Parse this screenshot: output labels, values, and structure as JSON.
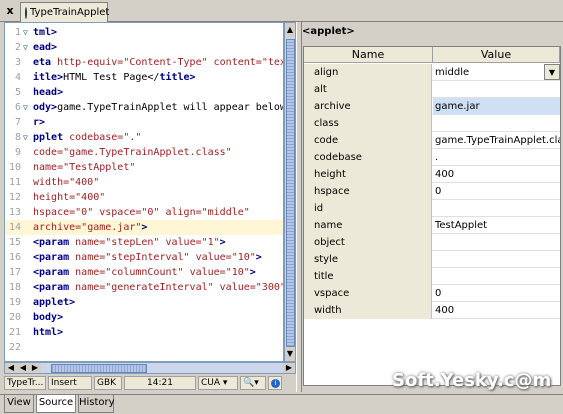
{
  "tab": {
    "title": "TypeTrainApplet",
    "close": "x"
  },
  "editor": {
    "lines": [
      {
        "n": "1",
        "fold": "▽",
        "segs": [
          [
            "tag",
            "tml>"
          ]
        ]
      },
      {
        "n": "2",
        "fold": "▽",
        "segs": [
          [
            "tag",
            "ead>"
          ]
        ]
      },
      {
        "n": "3",
        "fold": "",
        "segs": [
          [
            "tag",
            "eta "
          ],
          [
            "attr",
            "http-equiv="
          ],
          [
            "val",
            "\"Content-Type\" "
          ],
          [
            "attr",
            "content="
          ],
          [
            "val",
            "\"text"
          ]
        ]
      },
      {
        "n": "4",
        "fold": "",
        "segs": [
          [
            "tag",
            "itle>"
          ],
          [
            "txt",
            "HTML Test Page</"
          ],
          [
            "tag",
            "title>"
          ]
        ]
      },
      {
        "n": "5",
        "fold": "",
        "segs": [
          [
            "tag",
            "head>"
          ]
        ]
      },
      {
        "n": "6",
        "fold": "▽",
        "segs": [
          [
            "tag",
            "ody>"
          ],
          [
            "txt",
            "game.TypeTrainApplet will appear below"
          ]
        ]
      },
      {
        "n": "7",
        "fold": "",
        "segs": [
          [
            "tag",
            "r>"
          ]
        ]
      },
      {
        "n": "8",
        "fold": "▽",
        "segs": [
          [
            "tag",
            "pplet "
          ],
          [
            "attr",
            "codebase="
          ],
          [
            "val",
            "\".\""
          ]
        ]
      },
      {
        "n": "9",
        "fold": "",
        "segs": [
          [
            "attr",
            "code="
          ],
          [
            "val",
            "\"game.TypeTrainApplet.class\""
          ]
        ]
      },
      {
        "n": "10",
        "fold": "",
        "segs": [
          [
            "attr",
            "name="
          ],
          [
            "val",
            "\"TestApplet\""
          ]
        ]
      },
      {
        "n": "11",
        "fold": "",
        "segs": [
          [
            "attr",
            "width="
          ],
          [
            "val",
            "\"400\""
          ]
        ]
      },
      {
        "n": "12",
        "fold": "",
        "segs": [
          [
            "attr",
            "height="
          ],
          [
            "val",
            "\"400\""
          ]
        ]
      },
      {
        "n": "13",
        "fold": "",
        "segs": [
          [
            "attr",
            "hspace="
          ],
          [
            "val",
            "\"0\" "
          ],
          [
            "attr",
            "vspace="
          ],
          [
            "val",
            "\"0\" "
          ],
          [
            "attr",
            "align="
          ],
          [
            "val",
            "\"middle\""
          ]
        ]
      },
      {
        "n": "14",
        "fold": "",
        "current": true,
        "segs": [
          [
            "attr",
            "archive="
          ],
          [
            "val",
            "\"game.jar\""
          ],
          [
            "tag",
            ">"
          ]
        ]
      },
      {
        "n": "15",
        "fold": "",
        "segs": [
          [
            "tag",
            "<param "
          ],
          [
            "attr",
            "name="
          ],
          [
            "val",
            "\"stepLen\" "
          ],
          [
            "attr",
            "value="
          ],
          [
            "val",
            "\"1\""
          ],
          [
            "tag",
            ">"
          ]
        ]
      },
      {
        "n": "16",
        "fold": "",
        "segs": [
          [
            "tag",
            "<param "
          ],
          [
            "attr",
            "name="
          ],
          [
            "val",
            "\"stepInterval\" "
          ],
          [
            "attr",
            "value="
          ],
          [
            "val",
            "\"10\""
          ],
          [
            "tag",
            ">"
          ]
        ]
      },
      {
        "n": "17",
        "fold": "",
        "segs": [
          [
            "tag",
            "<param "
          ],
          [
            "attr",
            "name="
          ],
          [
            "val",
            "\"columnCount\" "
          ],
          [
            "attr",
            "value="
          ],
          [
            "val",
            "\"10\""
          ],
          [
            "tag",
            ">"
          ]
        ]
      },
      {
        "n": "18",
        "fold": "",
        "segs": [
          [
            "tag",
            "<param "
          ],
          [
            "attr",
            "name="
          ],
          [
            "val",
            "\"generateInterval\" "
          ],
          [
            "attr",
            "value="
          ],
          [
            "val",
            "\"300\""
          ],
          [
            "tag",
            ">"
          ]
        ]
      },
      {
        "n": "19",
        "fold": "",
        "segs": [
          [
            "tag",
            "applet>"
          ]
        ]
      },
      {
        "n": "20",
        "fold": "",
        "segs": [
          [
            "tag",
            "body>"
          ]
        ]
      },
      {
        "n": "21",
        "fold": "",
        "segs": [
          [
            "tag",
            "html>"
          ]
        ]
      },
      {
        "n": "22",
        "fold": "",
        "segs": []
      }
    ]
  },
  "statusbar": {
    "file": "TypeTr...",
    "mode": "Insert",
    "encoding": "GBK",
    "position": "14:21",
    "keymap": "CUA"
  },
  "properties": {
    "header": "<applet>",
    "col_name": "Name",
    "col_value": "Value",
    "rows": [
      {
        "name": "align",
        "value": "middle",
        "dropdown": true
      },
      {
        "name": "alt",
        "value": ""
      },
      {
        "name": "archive",
        "value": "game.jar",
        "selected": true
      },
      {
        "name": "class",
        "value": ""
      },
      {
        "name": "code",
        "value": "game.TypeTrainApplet.class"
      },
      {
        "name": "codebase",
        "value": "."
      },
      {
        "name": "height",
        "value": "400"
      },
      {
        "name": "hspace",
        "value": "0"
      },
      {
        "name": "id",
        "value": ""
      },
      {
        "name": "name",
        "value": "TestApplet"
      },
      {
        "name": "object",
        "value": ""
      },
      {
        "name": "style",
        "value": ""
      },
      {
        "name": "title",
        "value": ""
      },
      {
        "name": "vspace",
        "value": "0"
      },
      {
        "name": "width",
        "value": "400"
      }
    ]
  },
  "watermark": "Soft.Yesky.c@m",
  "bottom_tabs": [
    "View",
    "Source",
    "History"
  ],
  "active_bottom_tab": "Source",
  "colors": {
    "tag": "#000080",
    "attribute": "#9b1e1e",
    "selection": "#cfe0f5",
    "current_line": "#fff6d6"
  }
}
